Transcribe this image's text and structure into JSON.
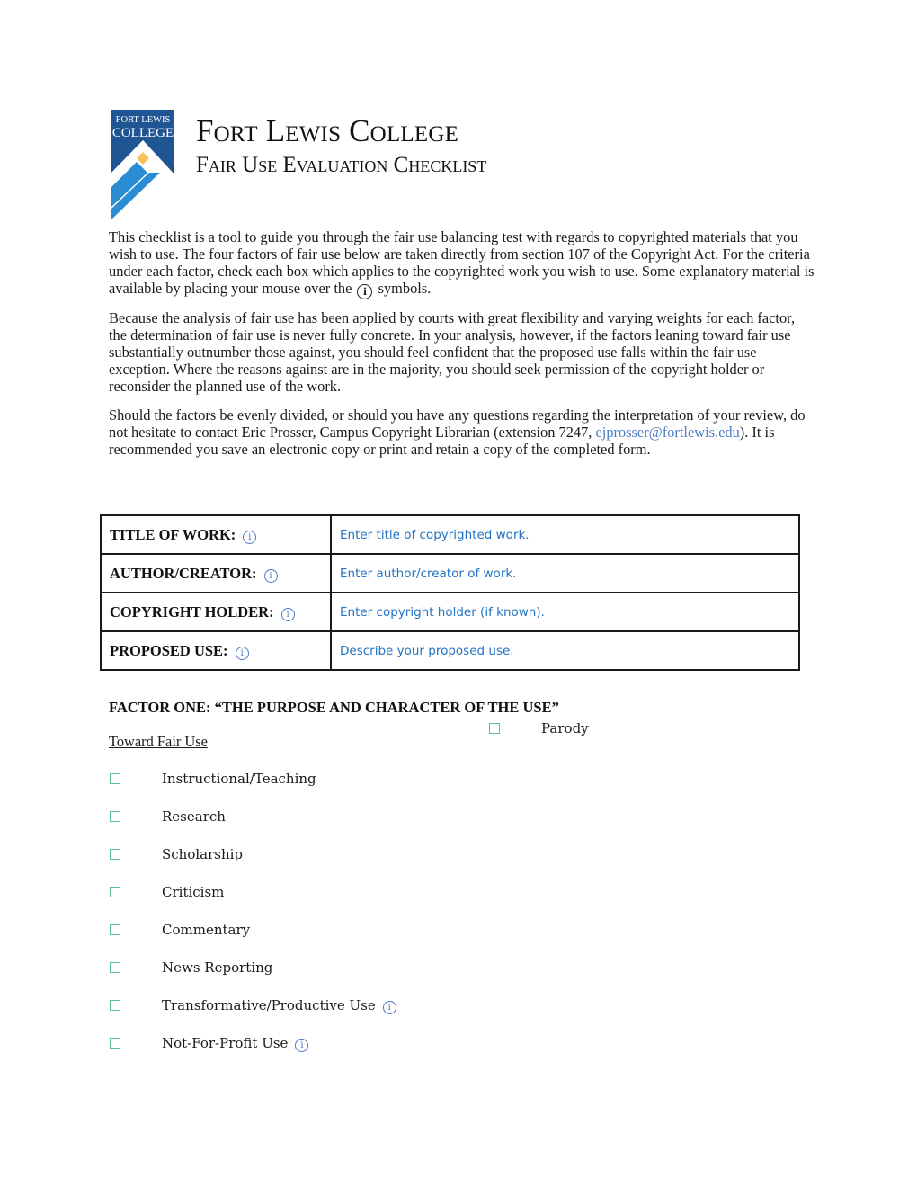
{
  "header": {
    "logo": {
      "line1": "FORT LEWIS",
      "line2": "COLLEGE",
      "colors": {
        "navy": "#1f5592",
        "blue": "#2a8dd3",
        "gold": "#f7c25a"
      }
    },
    "title": "Fort Lewis College",
    "subtitle": "Fair Use Evaluation Checklist"
  },
  "intro": {
    "p1_before_icon": "This checklist is a tool to guide you through the fair use balancing test with regards to copyrighted materials that you wish to use.  The four factors of fair use below are taken directly from section 107 of the Copyright Act. For the criteria under each factor, check each box which applies to the copyrighted work you wish to use. Some explanatory material is available by placing your mouse over the",
    "p1_icon": "i",
    "p1_after_icon": "symbols.",
    "p2": "Because the analysis of fair use has been applied by courts with great flexibility and varying weights for each factor, the determination of fair use is never fully concrete. In your analysis, however, if the factors leaning toward fair use substantially outnumber those against, you should feel confident that the proposed use falls within the fair use exception. Where the reasons against are in the majority, you should seek permission of the copyright holder or reconsider the planned use of the work.",
    "p3_before_link": "Should the factors be evenly divided, or should you have any questions regarding the interpretation of your review, do not hesitate to contact Eric Prosser, Campus Copyright Librarian (extension 7247, ",
    "p3_link": "ejprosser@fortlewis.edu",
    "p3_after_link": "). It is recommended you save an electronic copy or print and retain a copy of the completed form."
  },
  "work_info": [
    {
      "label": "TITLE OF WORK:",
      "placeholder": "Enter title of copyrighted work."
    },
    {
      "label": "AUTHOR/CREATOR:",
      "placeholder": "Enter author/creator of work."
    },
    {
      "label": "COPYRIGHT HOLDER:",
      "placeholder": "Enter copyright holder (if known)."
    },
    {
      "label": "PROPOSED USE:",
      "placeholder": "Describe your proposed use."
    }
  ],
  "info_icon_glyph": "i",
  "factor_one": {
    "title": "FACTOR ONE: “THE PURPOSE AND CHARACTER OF THE USE”",
    "toward_heading": "Toward Fair Use",
    "parody": {
      "label": "Parody",
      "checked": false
    },
    "toward_items": [
      {
        "label": "Instructional/Teaching",
        "checked": false
      },
      {
        "label": "Research",
        "checked": false
      },
      {
        "label": "Scholarship",
        "checked": false
      },
      {
        "label": "Criticism",
        "checked": false
      },
      {
        "label": "Commentary",
        "checked": false
      },
      {
        "label": "News Reporting",
        "checked": false
      },
      {
        "label": "Transformative/Productive Use",
        "checked": false,
        "has_info": true
      },
      {
        "label": "Not-For-Profit Use",
        "checked": false,
        "has_info": true
      }
    ]
  }
}
